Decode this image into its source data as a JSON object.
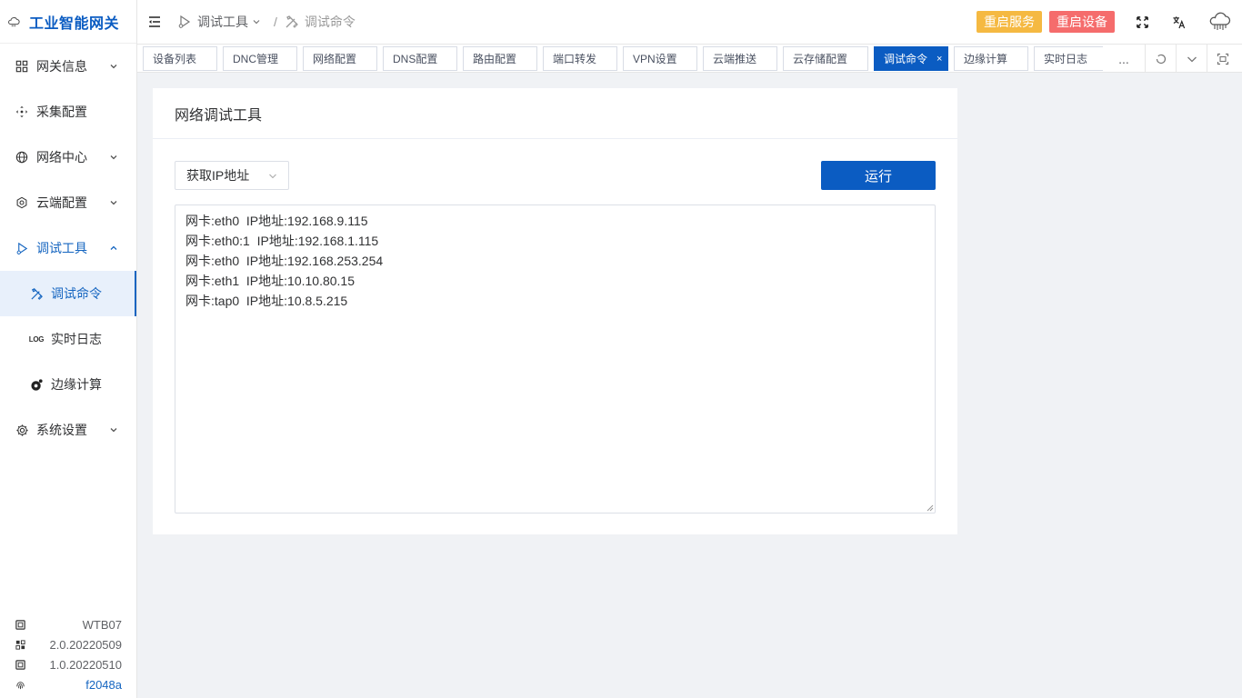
{
  "app": {
    "title": "工业智能网关"
  },
  "sidebar": {
    "items": [
      {
        "label": "网关信息",
        "icon": "grid-icon",
        "expandable": true
      },
      {
        "label": "采集配置",
        "icon": "move-icon",
        "expandable": false
      },
      {
        "label": "网络中心",
        "icon": "globe-icon",
        "expandable": true
      },
      {
        "label": "云端配置",
        "icon": "settings-icon",
        "expandable": true
      },
      {
        "label": "调试工具",
        "icon": "debug-icon",
        "expandable": true,
        "expanded": true
      },
      {
        "label": "系统设置",
        "icon": "gear-icon",
        "expandable": true
      }
    ],
    "sub_items": [
      {
        "label": "调试命令",
        "icon": "tools-icon",
        "selected": true
      },
      {
        "label": "实时日志",
        "icon": "log-icon",
        "glyph": "LOG"
      },
      {
        "label": "边缘计算",
        "icon": "edge-icon"
      }
    ],
    "sysinfo": [
      {
        "icon": "chip-icon",
        "value": "WTB07"
      },
      {
        "icon": "firmware-icon",
        "value": "2.0.20220509"
      },
      {
        "icon": "chip-icon",
        "value": "1.0.20220510"
      },
      {
        "icon": "fingerprint-icon",
        "value": "f2048a"
      }
    ]
  },
  "header": {
    "breadcrumb": {
      "parent": "调试工具",
      "separator": "/",
      "current": "调试命令"
    },
    "restart_service": "重启服务",
    "restart_device": "重启设备"
  },
  "tabs": [
    {
      "label": "设备列表"
    },
    {
      "label": "DNC管理"
    },
    {
      "label": "网络配置"
    },
    {
      "label": "DNS配置"
    },
    {
      "label": "路由配置"
    },
    {
      "label": "端口转发"
    },
    {
      "label": "VPN设置"
    },
    {
      "label": "云端推送"
    },
    {
      "label": "云存储配置"
    },
    {
      "label": "调试命令",
      "active": true,
      "close": "×"
    },
    {
      "label": "边缘计算"
    },
    {
      "label": "实时日志"
    }
  ],
  "tabs_more": "...",
  "card": {
    "title": "网络调试工具",
    "select_value": "获取IP地址",
    "run_label": "运行",
    "output_lines": [
      "网卡:eth0  IP地址:192.168.9.115",
      "网卡:eth0:1  IP地址:192.168.1.115",
      "网卡:eth0  IP地址:192.168.253.254",
      "网卡:eth1  IP地址:10.10.80.15",
      "网卡:tap0  IP地址:10.8.5.215"
    ]
  },
  "colors": {
    "primary": "#0b5cc2",
    "warning": "#f5b942",
    "danger": "#f56c6c"
  }
}
